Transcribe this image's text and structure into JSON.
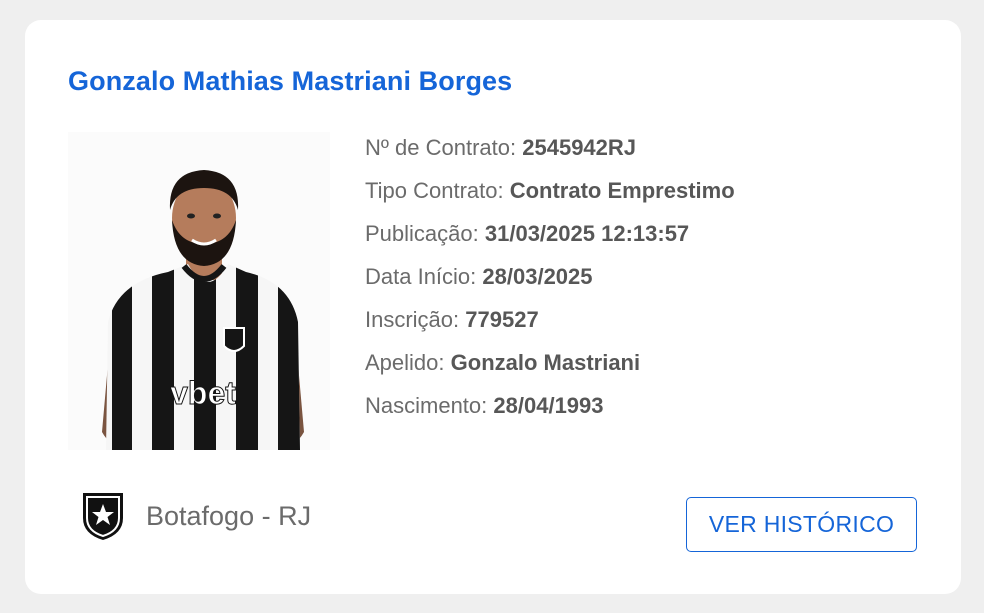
{
  "player": {
    "name": "Gonzalo Mathias Mastriani Borges",
    "jersey_sponsor": "vbet"
  },
  "details": [
    {
      "label": "Nº de Contrato:",
      "value": "2545942RJ"
    },
    {
      "label": "Tipo Contrato:",
      "value": "Contrato Emprestimo"
    },
    {
      "label": "Publicação:",
      "value": "31/03/2025 12:13:57"
    },
    {
      "label": "Data Início:",
      "value": "28/03/2025"
    },
    {
      "label": "Inscrição:",
      "value": "779527"
    },
    {
      "label": "Apelido:",
      "value": "Gonzalo Mastriani"
    },
    {
      "label": "Nascimento:",
      "value": "28/04/1993"
    }
  ],
  "club": {
    "name": "Botafogo - RJ",
    "crest_icon": "botafogo-star-shield-icon"
  },
  "actions": {
    "history_label": "VER HISTÓRICO"
  },
  "colors": {
    "accent": "#1565d8",
    "text": "#6b6b6b",
    "card": "#ffffff",
    "page": "#efefef"
  }
}
